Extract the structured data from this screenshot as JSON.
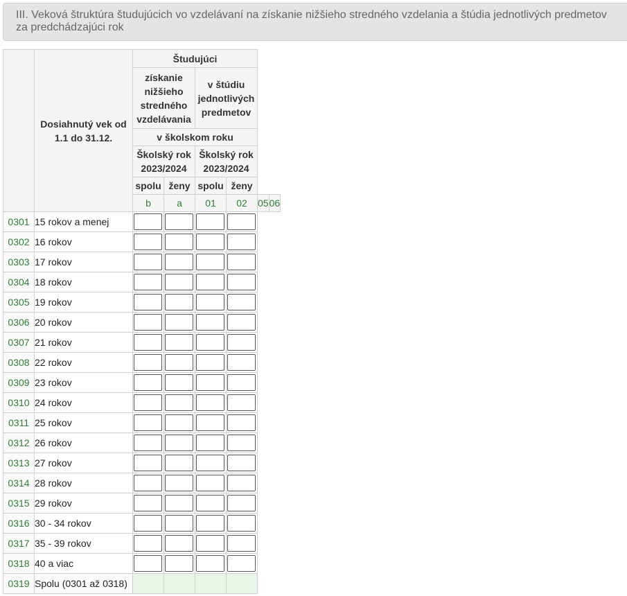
{
  "section": {
    "title": "III. Veková štruktúra študujúcich vo vzdelávaní na získanie nižšieho stredného vzdelania a štúdia jednotlivých predmetov za predchádzajúci rok"
  },
  "table": {
    "age_header": "Dosiahnutý vek od 1.1 do 31.12.",
    "group_header": "Študujúci",
    "col_group_1": "získanie nižšieho stredného vzdelávania",
    "col_group_2": "v štúdiu jednotlivých predmetov",
    "period_header": "v školskom roku",
    "year_1": "Školský rok 2023/2024",
    "year_2": "Školský rok 2023/2024",
    "sub_headers": [
      "spolu",
      "ženy",
      "spolu",
      "ženy"
    ],
    "index_row": [
      "b",
      "a",
      "01",
      "02",
      "05",
      "06"
    ],
    "rows": [
      {
        "code": "0301",
        "label": "15 rokov a menej"
      },
      {
        "code": "0302",
        "label": "16 rokov"
      },
      {
        "code": "0303",
        "label": "17 rokov"
      },
      {
        "code": "0304",
        "label": "18 rokov"
      },
      {
        "code": "0305",
        "label": "19 rokov"
      },
      {
        "code": "0306",
        "label": "20 rokov"
      },
      {
        "code": "0307",
        "label": "21 rokov"
      },
      {
        "code": "0308",
        "label": "22 rokov"
      },
      {
        "code": "0309",
        "label": "23 rokov"
      },
      {
        "code": "0310",
        "label": "24 rokov"
      },
      {
        "code": "0311",
        "label": "25 rokov"
      },
      {
        "code": "0312",
        "label": "26 rokov"
      },
      {
        "code": "0313",
        "label": "27 rokov"
      },
      {
        "code": "0314",
        "label": "28 rokov"
      },
      {
        "code": "0315",
        "label": "29 rokov"
      },
      {
        "code": "0316",
        "label": "30 - 34 rokov"
      },
      {
        "code": "0317",
        "label": "35 - 39 rokov"
      },
      {
        "code": "0318",
        "label": "40 a viac"
      }
    ],
    "total_row": {
      "code": "0319",
      "label": "Spolu (0301 až 0318)"
    }
  }
}
